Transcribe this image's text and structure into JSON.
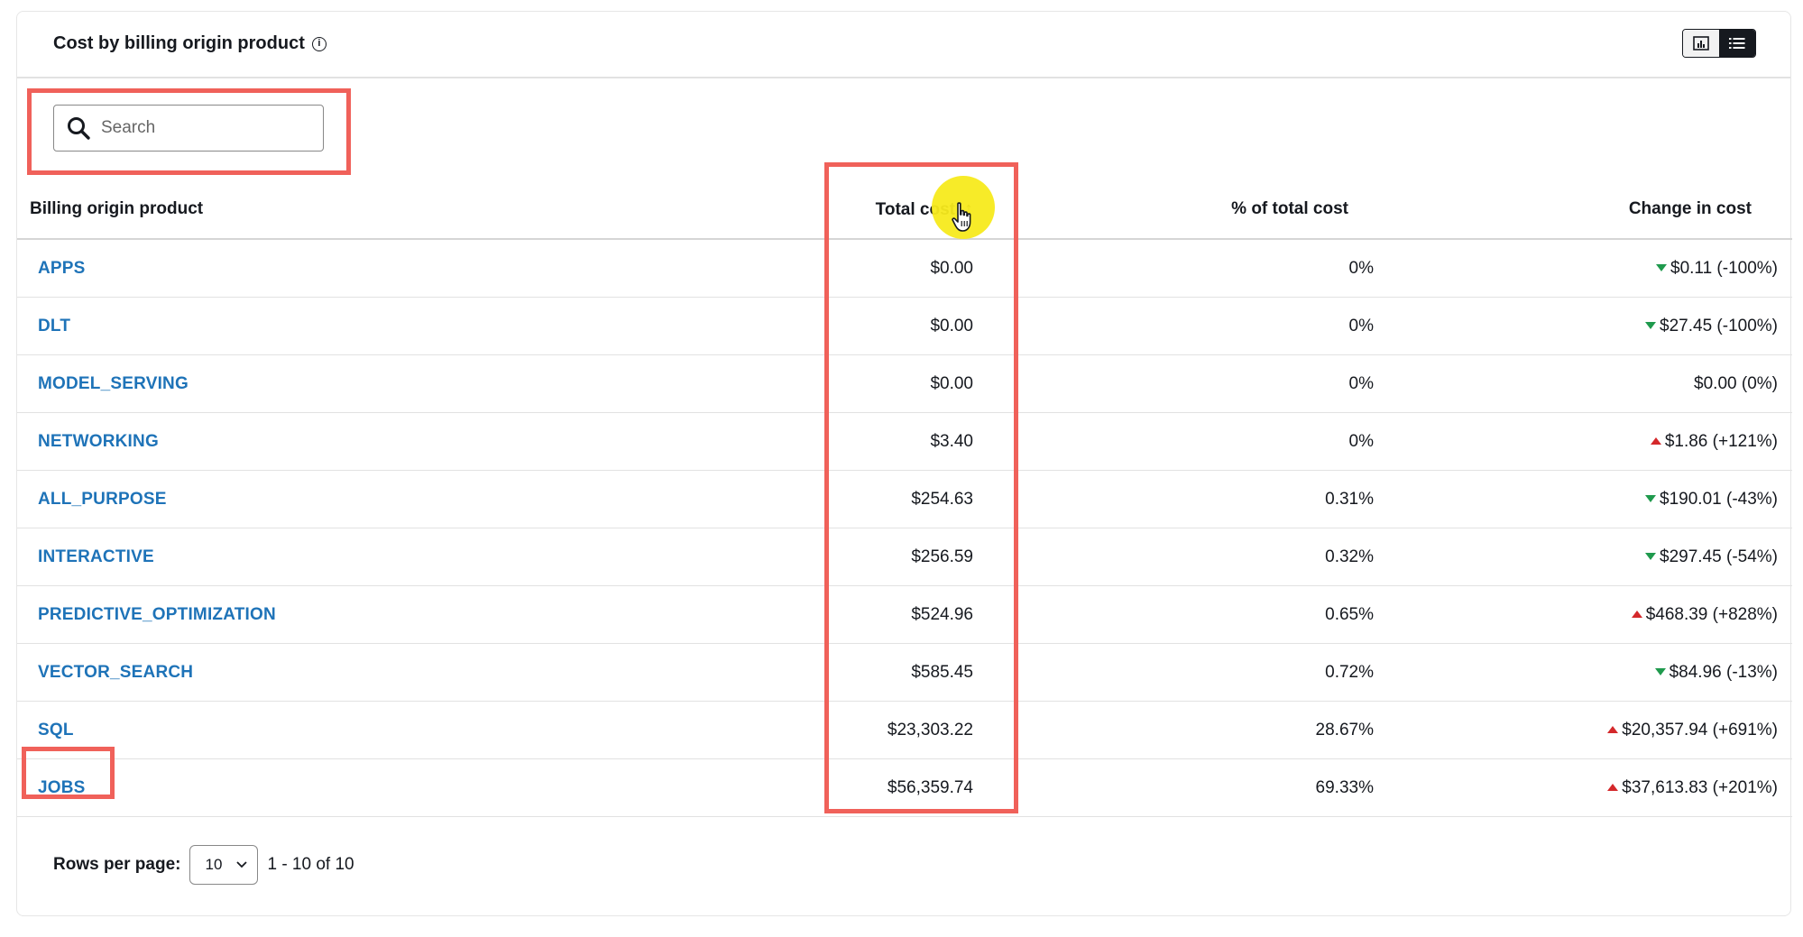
{
  "panel": {
    "title": "Cost by billing origin product",
    "info_icon": "info-icon",
    "view_toggle": {
      "chart_icon": "bar-chart-icon",
      "list_icon": "list-icon",
      "active": "list"
    }
  },
  "search": {
    "placeholder": "Search",
    "value": ""
  },
  "table": {
    "headers": {
      "product": "Billing origin product",
      "total": "Total cost",
      "pct": "% of total cost",
      "change": "Change in cost"
    },
    "sort": {
      "column": "total",
      "direction": "ascending",
      "icon": "arrow-up-icon"
    },
    "rows": [
      {
        "product": "APPS",
        "total": "$0.00",
        "pct": "0%",
        "change": "$0.11 (-100%)",
        "trend": "down"
      },
      {
        "product": "DLT",
        "total": "$0.00",
        "pct": "0%",
        "change": "$27.45 (-100%)",
        "trend": "down"
      },
      {
        "product": "MODEL_SERVING",
        "total": "$0.00",
        "pct": "0%",
        "change": "$0.00 (0%)",
        "trend": "none"
      },
      {
        "product": "NETWORKING",
        "total": "$3.40",
        "pct": "0%",
        "change": "$1.86 (+121%)",
        "trend": "up"
      },
      {
        "product": "ALL_PURPOSE",
        "total": "$254.63",
        "pct": "0.31%",
        "change": "$190.01 (-43%)",
        "trend": "down"
      },
      {
        "product": "INTERACTIVE",
        "total": "$256.59",
        "pct": "0.32%",
        "change": "$297.45 (-54%)",
        "trend": "down"
      },
      {
        "product": "PREDICTIVE_OPTIMIZATION",
        "total": "$524.96",
        "pct": "0.65%",
        "change": "$468.39 (+828%)",
        "trend": "up"
      },
      {
        "product": "VECTOR_SEARCH",
        "total": "$585.45",
        "pct": "0.72%",
        "change": "$84.96 (-13%)",
        "trend": "down"
      },
      {
        "product": "SQL",
        "total": "$23,303.22",
        "pct": "28.67%",
        "change": "$20,357.94 (+691%)",
        "trend": "up"
      },
      {
        "product": "JOBS",
        "total": "$56,359.74",
        "pct": "69.33%",
        "change": "$37,613.83 (+201%)",
        "trend": "up"
      }
    ]
  },
  "pagination": {
    "rows_label": "Rows per page:",
    "page_size": "10",
    "range": "1 - 10 of 10"
  },
  "colors": {
    "link": "#1e73b8",
    "highlight": "#f0615a",
    "trend_down": "#1f9a4d",
    "trend_up": "#d4282b",
    "cursor_spot": "#f7ea1c"
  }
}
